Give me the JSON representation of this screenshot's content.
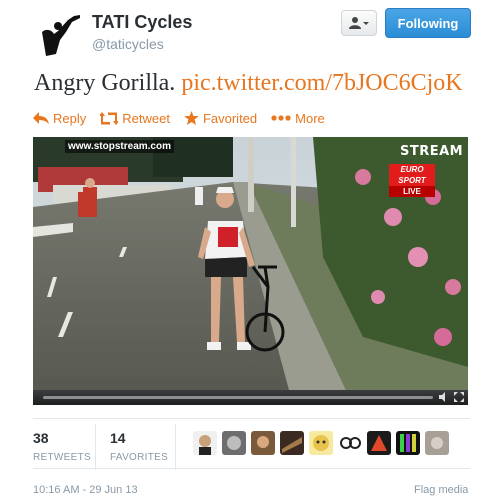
{
  "user": {
    "name": "TATI Cycles",
    "handle": "@taticycles"
  },
  "header": {
    "follow_label": "Following",
    "user_menu_icon": "user-dropdown-icon"
  },
  "tweet": {
    "text": "Angry Gorilla.",
    "link": "pic.twitter.com/7bJOC6CjoK"
  },
  "actions": {
    "reply": "Reply",
    "retweet": "Retweet",
    "favorited": "Favorited",
    "more": "More"
  },
  "video": {
    "watermark": "www.stopstream.com",
    "stream_logo": "STREAM",
    "channel_line1": "EURO",
    "channel_line2": "SPORT",
    "channel_live": "LIVE"
  },
  "stats": {
    "retweets_count": "38",
    "retweets_label": "RETWEETS",
    "favorites_count": "14",
    "favorites_label": "FAVORITES"
  },
  "footer": {
    "timestamp": "10:16 AM - 29 Jun 13",
    "flag_media": "Flag media"
  },
  "colors": {
    "accent": "#e8761f",
    "follow_button": "#2b8dd6",
    "muted": "#8899a6"
  }
}
